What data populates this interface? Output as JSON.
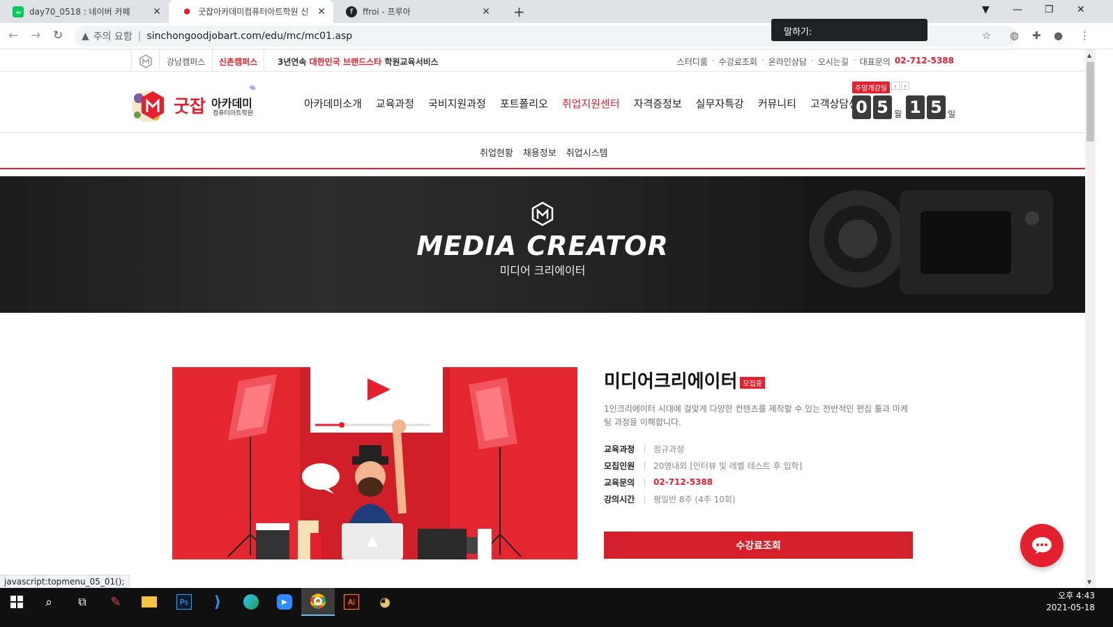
{
  "browser": {
    "tabs": [
      {
        "title": "day70_0518 : 네이버 카페",
        "active": false
      },
      {
        "title": "굿잡아카데미컴퓨터아트학원 신",
        "active": true
      },
      {
        "title": "ffroi - 프루아",
        "active": false
      }
    ],
    "security_text": "주의 요함",
    "url": "sinchongoodjobart.com/edu/mc/mc01.asp",
    "tooltip": "말하기:"
  },
  "topbar": {
    "campus_gangnam": "강남캠퍼스",
    "campus_sinchon": "신촌캠퍼스",
    "slogan_prefix": "3년연속",
    "slogan_brand": "대한민국 브랜드스타",
    "slogan_suffix": "학원교육서비스",
    "util_links": [
      "스터디룸",
      "수강료조회",
      "온라인상담",
      "오시는길"
    ],
    "phone_label": "대표문의",
    "phone": "02-712-5388"
  },
  "header": {
    "logo_text_main": "굿잡",
    "logo_text_academy": "아카데미",
    "logo_text_sub": "컴퓨터아트학원",
    "gnb": [
      "아카데미소개",
      "교육과정",
      "국비지원과정",
      "포트폴리오",
      "취업지원센터",
      "자격증정보",
      "실무자특강",
      "커뮤니티",
      "고객상담센터"
    ],
    "gnb_active": "취업지원센터",
    "counter_badge": "주말개강일",
    "month_digits": [
      "0",
      "5"
    ],
    "month_unit": "월",
    "day_digits": [
      "1",
      "5"
    ],
    "day_unit": "일"
  },
  "subnav": [
    "취업현황",
    "채용정보",
    "취업시스템"
  ],
  "hero": {
    "title": "MEDIA CREATOR",
    "subtitle": "미디어 크리에이터"
  },
  "course": {
    "title": "미디어크리에이터",
    "badge": "모집중",
    "description": "1인크리에이터 시대에 걸맞게 다양한 컨텐츠를 제작할 수 있는 전반적인 편집 툴과 마케팅 과정을 이해합니다.",
    "rows": [
      {
        "key": "교육과정",
        "value": "정규과정"
      },
      {
        "key": "모집인원",
        "value": "20명내외 [인터뷰 및 레벨 테스트 후 입학]"
      },
      {
        "key": "교육문의",
        "value": "02-712-5388"
      },
      {
        "key": "강의시간",
        "value": "평일반 8주 (4주 10회)"
      }
    ],
    "cta": "수강료조회"
  },
  "statusbar": "javascript:topmenu_05_01();",
  "taskbar": {
    "time": "오후 4:43",
    "date": "2021-05-18"
  },
  "colors": {
    "accent": "#e4202f",
    "hero_bg": "#1c1c1c"
  }
}
